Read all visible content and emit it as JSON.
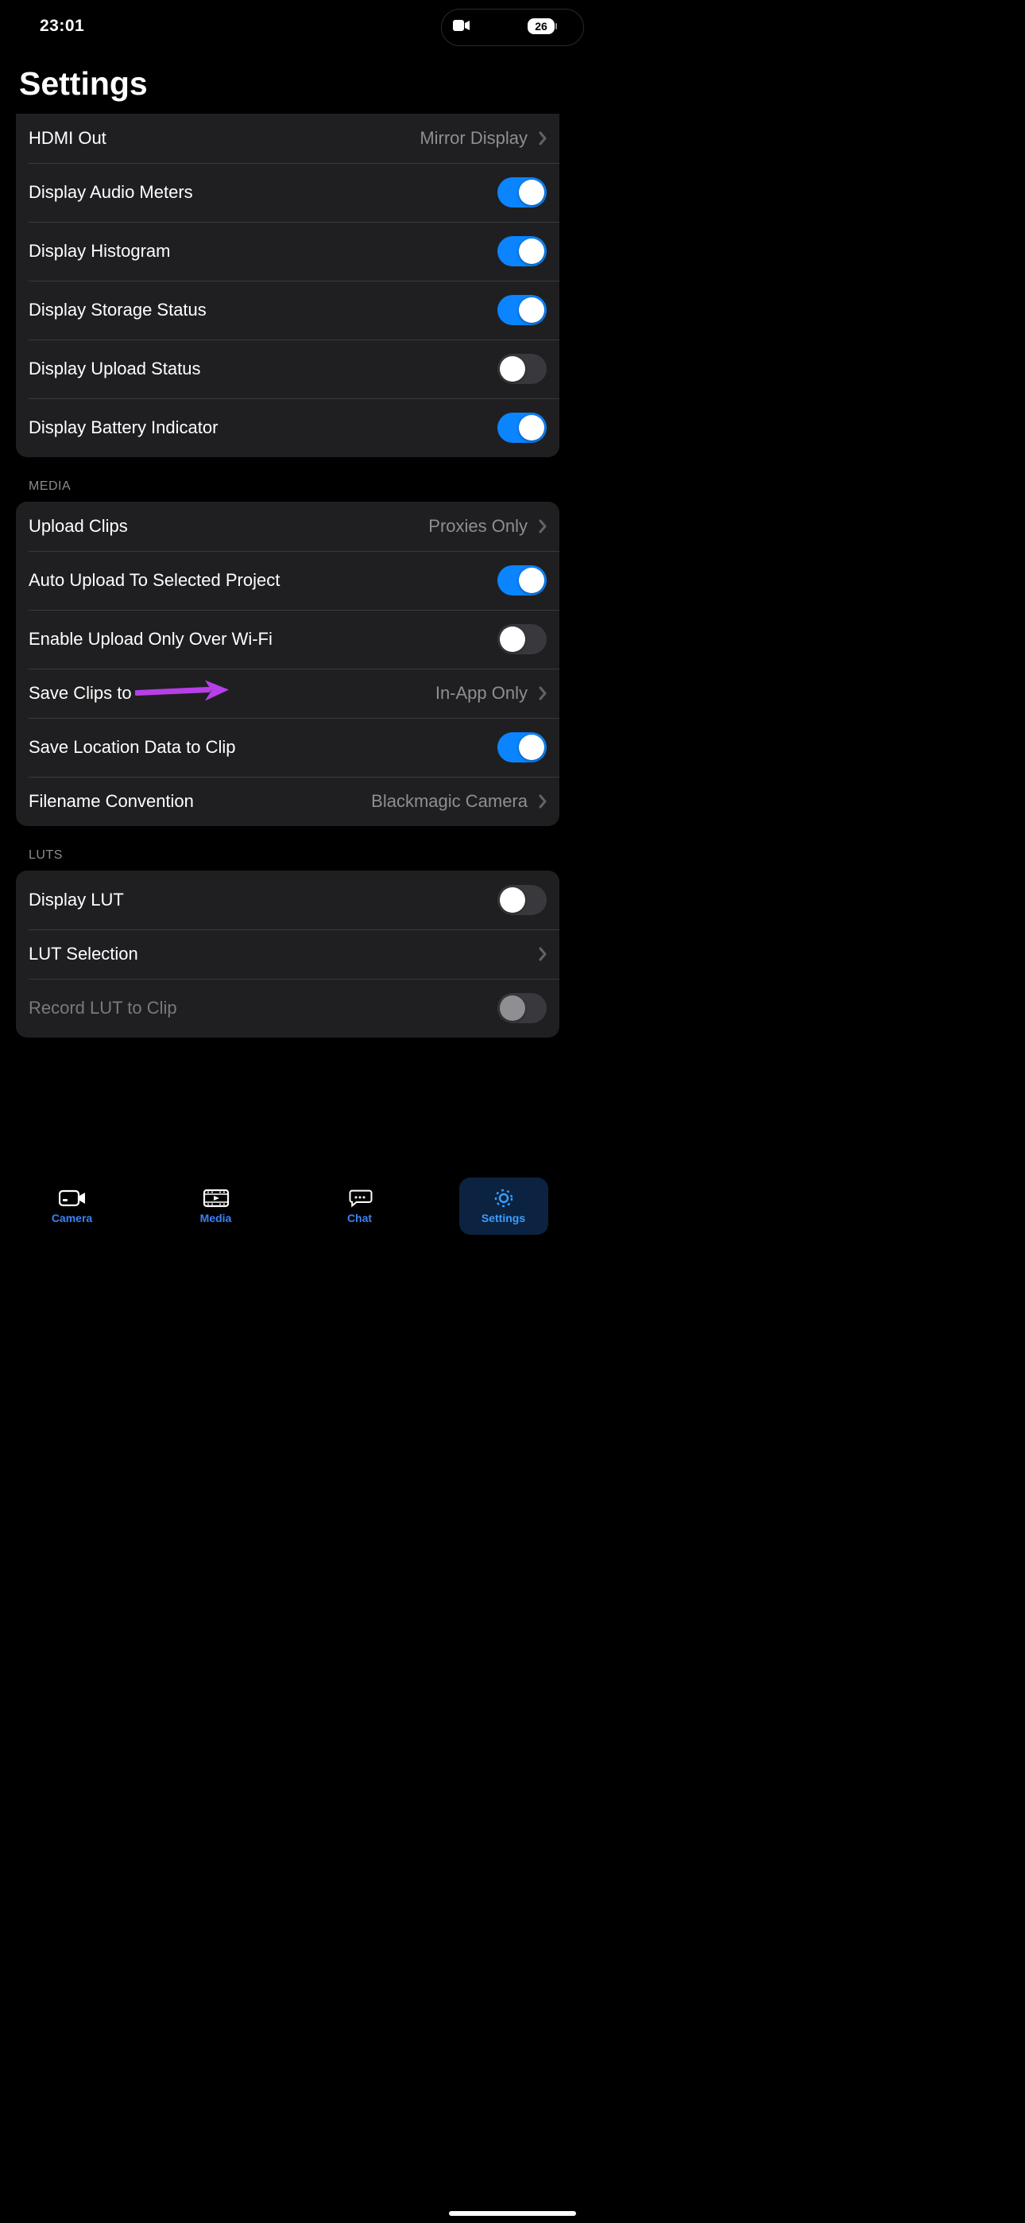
{
  "status": {
    "time": "23:01",
    "battery": "26"
  },
  "title": "Settings",
  "groups": {
    "display": {
      "hdmi_out": {
        "label": "HDMI Out",
        "value": "Mirror Display"
      },
      "audio_meters": {
        "label": "Display Audio Meters",
        "on": true
      },
      "histogram": {
        "label": "Display Histogram",
        "on": true
      },
      "storage_status": {
        "label": "Display Storage Status",
        "on": true
      },
      "upload_status": {
        "label": "Display Upload Status",
        "on": false
      },
      "battery_indicator": {
        "label": "Display Battery Indicator",
        "on": true
      }
    },
    "media_header": "MEDIA",
    "media": {
      "upload_clips": {
        "label": "Upload Clips",
        "value": "Proxies Only"
      },
      "auto_upload": {
        "label": "Auto Upload To Selected Project",
        "on": true
      },
      "wifi_only": {
        "label": "Enable Upload Only Over Wi-Fi",
        "on": false
      },
      "save_clips_to": {
        "label": "Save Clips to",
        "value": "In-App Only"
      },
      "save_location": {
        "label": "Save Location Data to Clip",
        "on": true
      },
      "filename_convention": {
        "label": "Filename Convention",
        "value": "Blackmagic Camera"
      }
    },
    "luts_header": "LUTS",
    "luts": {
      "display_lut": {
        "label": "Display LUT",
        "on": false
      },
      "lut_selection": {
        "label": "LUT Selection"
      },
      "record_lut": {
        "label": "Record LUT to Clip",
        "on": false,
        "disabled": true
      }
    }
  },
  "tabs": {
    "camera": "Camera",
    "media": "Media",
    "chat": "Chat",
    "settings": "Settings"
  },
  "annotation": {
    "target": "save_clips_to",
    "color": "#b63fe8"
  }
}
